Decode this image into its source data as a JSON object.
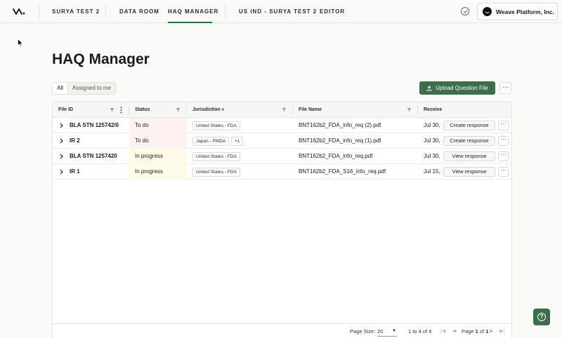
{
  "nav": {
    "workspace": "SURYA TEST 2",
    "links": [
      {
        "label": "DATA ROOM"
      },
      {
        "label": "HAQ MANAGER",
        "active": true
      },
      {
        "label": "US IND - SURYA TEST 2"
      },
      {
        "label": "EDITOR"
      }
    ],
    "org_name": "Weave Platform, Inc.",
    "accent_color": "#2f6b46"
  },
  "page": {
    "title": "HAQ Manager",
    "filter_tabs": [
      {
        "label": "All",
        "active": true
      },
      {
        "label": "Assigned to me",
        "active": false
      }
    ],
    "upload_label": "Upload Question File",
    "more_label": "···"
  },
  "table": {
    "columns": [
      {
        "label": "File ID"
      },
      {
        "label": "Status"
      },
      {
        "label": "Jurisdiction"
      },
      {
        "label": "File Name"
      },
      {
        "label": "Receive"
      }
    ],
    "rows": [
      {
        "file_id": "BLA STN 125742/0",
        "status": "To do",
        "status_kind": "todo",
        "jurisdiction": "United States - FDA",
        "jurisdiction_extra": "",
        "file_name": "BNT162b2_FDA_info_req (2).pdf",
        "received": "Jul 30,",
        "action": "Create response"
      },
      {
        "file_id": "IR 2",
        "status": "To do",
        "status_kind": "todo",
        "jurisdiction": "Japan - PMDA",
        "jurisdiction_extra": "+1",
        "file_name": "BNT162b2_FDA_info_req (1).pdf",
        "received": "Jul 30,",
        "action": "Create response"
      },
      {
        "file_id": "BLA STN 1257420",
        "status": "In progress",
        "status_kind": "progress",
        "jurisdiction": "United States - FDA",
        "jurisdiction_extra": "",
        "file_name": "BNT162b2_FDA_info_req.pdf",
        "received": "Jul 30,",
        "action": "View response"
      },
      {
        "file_id": "IR 1",
        "status": "In progress",
        "status_kind": "progress",
        "jurisdiction": "United States - FDA",
        "jurisdiction_extra": "",
        "file_name": "BNT162b2_FDA_S16_info_req.pdf",
        "received": "Jul 15, :",
        "action": "View response"
      }
    ],
    "row_more_label": "···"
  },
  "footer": {
    "page_size_label": "Page Size:",
    "page_size_value": "20",
    "range_text": "1 to 4 of 4",
    "page_prefix": "Page",
    "page_current": "1",
    "page_of": "of",
    "page_total": "1"
  },
  "help": {
    "label": "?"
  }
}
